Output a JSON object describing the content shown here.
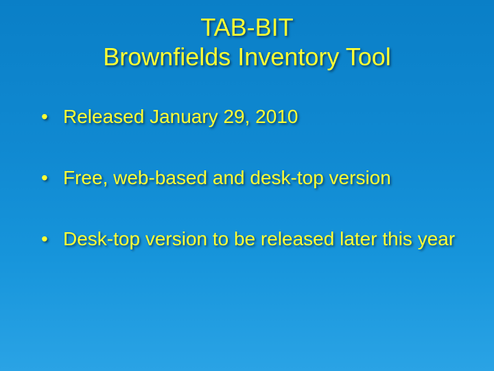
{
  "title_line1": "TAB-BIT",
  "title_line2": "Brownfields Inventory Tool",
  "bullets": [
    "Released January 29, 2010",
    "Free, web-based and desk-top version",
    "Desk-top version to be released later this year"
  ]
}
